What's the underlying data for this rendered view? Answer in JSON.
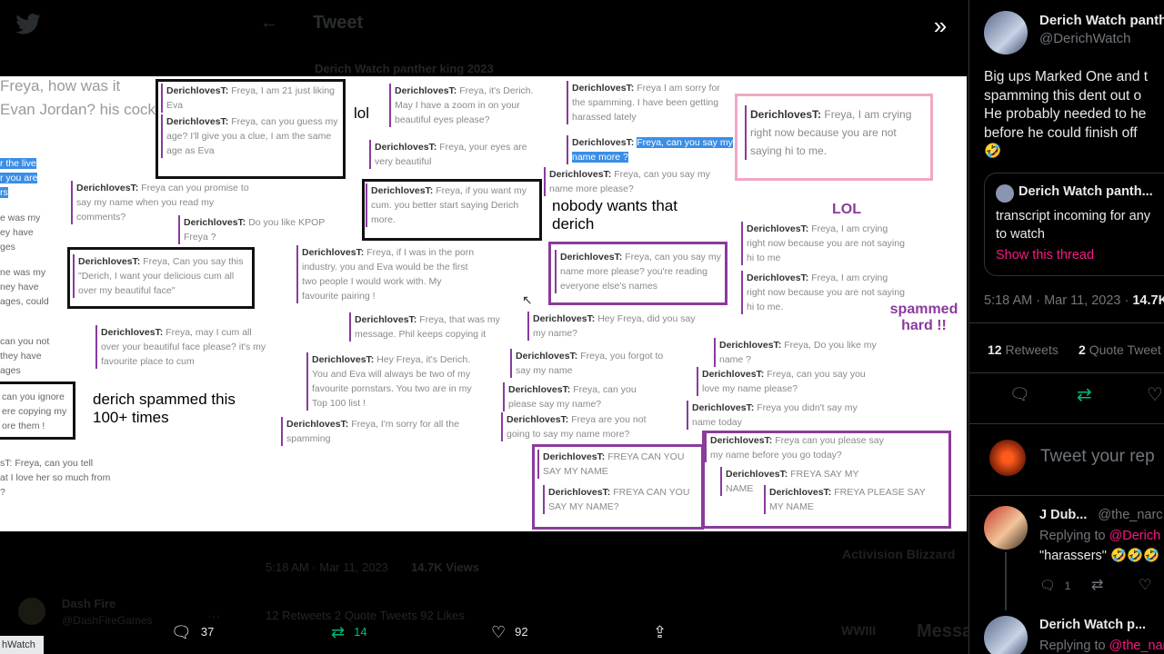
{
  "background": {
    "header_title": "Tweet",
    "author": "Derich Watch panther king 2023",
    "date": "5:18 AM · Mar 11, 2023",
    "views": "14.7K Views",
    "stats": "12 Retweets   2 Quote Tweets   92 Likes",
    "activision": "Activision Blizzard",
    "dash_name": "Dash Fire",
    "dash_handle": "@DashFireGames",
    "messages": "Messages",
    "wwiii": "WWIII"
  },
  "image": {
    "frags": {
      "f1": "Freya, how was it",
      "f2": "Evan Jordan? his cock",
      "f3": "r the live",
      "f4": "r you are",
      "f5": "rs",
      "f6": "e was my",
      "f7": "ey have",
      "f8": "ges",
      "f9": "ne was my",
      "f10": "ney have",
      "f11": "ages, could",
      "f12": "can you not",
      "f13": "they have",
      "f14": "ages",
      "f15": "can you ignore",
      "f16": "ere copying my",
      "f17": "ore them !",
      "f18": "sT: Freya, can you tell",
      "f19": "at I love her so much from",
      "f20": "?"
    },
    "messages": {
      "m1": {
        "user": "DerichlovesT:",
        "text": "Freya, I am 21 just liking Eva"
      },
      "m2": {
        "user": "DerichlovesT:",
        "text": "Freya, can you guess my age? I'll give you a clue, I am the same age as Eva"
      },
      "m3": {
        "user": "DerichlovesT:",
        "text": "Freya can you promise to say my name when you read my comments?"
      },
      "m4": {
        "user": "DerichlovesT:",
        "text": "Do you like KPOP Freya ?"
      },
      "m5": {
        "user": "DerichlovesT:",
        "text": "Freya, Can you say this \"Derich, I want your delicious cum all over my beautiful face\""
      },
      "m6": {
        "user": "DerichlovesT:",
        "text": "Freya, may I cum all over your beautiful face please? it's my favourite place to cum"
      },
      "m7": {
        "user": "DerichlovesT:",
        "text": "Freya, it's Derich. May I have a zoom in on your beautiful eyes please?"
      },
      "m8": {
        "user": "DerichlovesT:",
        "text": "Freya, your eyes are very beautiful"
      },
      "m9": {
        "user": "DerichlovesT:",
        "text": "Freya, if you want my cum. you better start saying Derich more."
      },
      "m10": {
        "user": "DerichlovesT:",
        "text": "Freya, if I was in the porn industry. you and Eva would be the first two people I would work with. My favourite pairing !"
      },
      "m11": {
        "user": "DerichlovesT:",
        "text": "Freya, that was my message. Phil keeps copying it"
      },
      "m12": {
        "user": "DerichlovesT:",
        "text": "Hey Freya, it's Derich. You and Eva will always be two of my favourite pornstars. You two are in my Top 100 list !"
      },
      "m13": {
        "user": "DerichlovesT:",
        "text": "Freya, I'm sorry for all the spamming"
      },
      "m14": {
        "user": "DerichlovesT:",
        "text": "Freya I am sorry for the spamming. I have been getting harassed lately"
      },
      "m15": {
        "user": "DerichlovesT:",
        "text": "Freya, can you say my name more ?"
      },
      "m16": {
        "user": "DerichlovesT:",
        "text": "Freya, can you say my name more please?"
      },
      "m17": {
        "user": "DerichlovesT:",
        "text": "Freya, can you say my name more please? you're reading everyone else's names"
      },
      "m18": {
        "user": "DerichlovesT:",
        "text": "Hey Freya, did you say my name?"
      },
      "m19": {
        "user": "DerichlovesT:",
        "text": "Freya, you forgot to say my name"
      },
      "m20": {
        "user": "DerichlovesT:",
        "text": "Freya, can you please say my name?"
      },
      "m21": {
        "user": "DerichlovesT:",
        "text": "Freya are you not going to say my name more?"
      },
      "m22": {
        "user": "DerichlovesT:",
        "text": "FREYA CAN YOU SAY MY NAME"
      },
      "m23": {
        "user": "DerichlovesT:",
        "text": "FREYA CAN YOU SAY MY NAME?"
      },
      "m24": {
        "user": "DerichlovesT:",
        "text": "Freya, I am crying right now because you are not saying hi to me."
      },
      "m25": {
        "user": "DerichlovesT:",
        "text": "Freya, I am crying right now because you are not saying hi to me"
      },
      "m26": {
        "user": "DerichlovesT:",
        "text": "Freya, I am crying right now because you are not saying hi to me."
      },
      "m27": {
        "user": "DerichlovesT:",
        "text": "Freya, Do you like my name ?"
      },
      "m28": {
        "user": "DerichlovesT:",
        "text": "Freya, can you say you love my name please?"
      },
      "m29": {
        "user": "DerichlovesT:",
        "text": "Freya you didn't say my name today"
      },
      "m30": {
        "user": "DerichlovesT:",
        "text": "Freya can you please say my name before you go today?"
      },
      "m31": {
        "user": "DerichlovesT:",
        "text": "FREYA SAY MY NAME"
      },
      "m32": {
        "user": "DerichlovesT:",
        "text": "FREYA PLEASE SAY MY NAME"
      }
    },
    "annotations": {
      "lol": "lol",
      "nobody": "nobody wants that derich",
      "spammed100": "derich spammed this 100+ times",
      "LOL": "LOL",
      "spammed_hard": "spammed hard !!"
    }
  },
  "actions": {
    "reply_count": "37",
    "retweet_count": "14",
    "like_count": "92"
  },
  "status_chip": "hWatch",
  "right": {
    "author_name": "Derich Watch panth",
    "author_handle": "@DerichWatch",
    "tweet_lines": [
      "Big ups Marked One and t",
      "spamming this dent out o",
      "He probably needed to he",
      "before he could finish off"
    ],
    "emoji": "🤣",
    "quote_author": "Derich Watch panth...",
    "quote_lines": [
      "transcript incoming for any",
      "to watch"
    ],
    "show_thread": "Show this thread",
    "timestamp": "5:18 AM · Mar 11, 2023 · ",
    "views": "14.7K",
    "retweets_num": "12",
    "retweets_label": "Retweets",
    "quotes_num": "2",
    "quotes_label": "Quote Tweet",
    "reply_placeholder": "Tweet your rep",
    "reply1_name": "J Dub...",
    "reply1_handle": "@the_narc.",
    "reply1_replying": "Replying to ",
    "reply1_mention": "@Derich",
    "reply1_text": "\"harassers\" 🤣🤣🤣",
    "reply1_count": "1",
    "reply2_name": "Derich Watch p...",
    "reply2_replying": "Replying to ",
    "reply2_mention": "@the_nar"
  }
}
